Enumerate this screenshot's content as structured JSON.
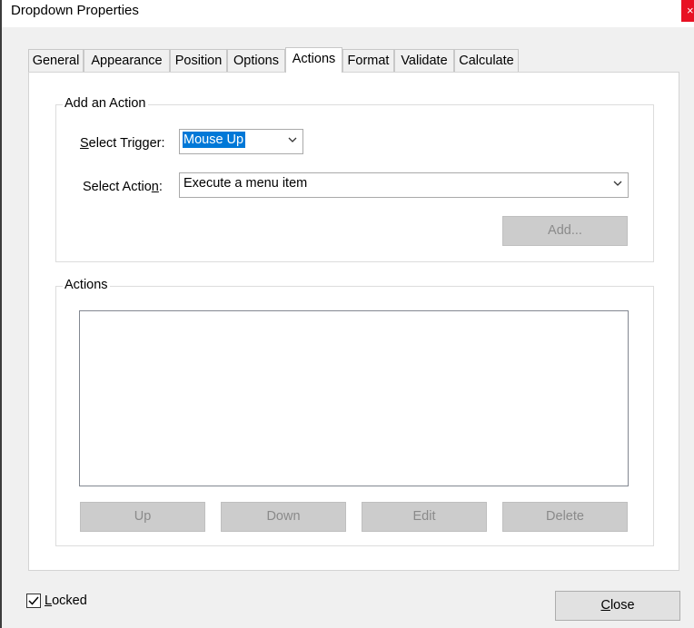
{
  "window": {
    "title": "Dropdown Properties",
    "close_glyph": "×"
  },
  "tabs": [
    {
      "label": "General"
    },
    {
      "label": "Appearance"
    },
    {
      "label": "Position"
    },
    {
      "label": "Options"
    },
    {
      "label": "Actions"
    },
    {
      "label": "Format"
    },
    {
      "label": "Validate"
    },
    {
      "label": "Calculate"
    }
  ],
  "add_action": {
    "group_label": "Add an Action",
    "trigger": {
      "label_mnemonic": "S",
      "label_rest": "elect Trigger:",
      "value": "Mouse Up"
    },
    "action": {
      "label_pre": "Select Actio",
      "label_mnemonic": "n",
      "label_post": ":",
      "value": "Execute a menu item"
    },
    "add_button": "Add..."
  },
  "actions_group": {
    "label": "Actions",
    "buttons": {
      "up": "Up",
      "down": "Down",
      "edit": "Edit",
      "delete": "Delete"
    }
  },
  "footer": {
    "locked_mnemonic": "L",
    "locked_rest": "ocked",
    "locked_checked": true,
    "close_mnemonic": "C",
    "close_rest": "lose"
  },
  "colors": {
    "selection": "#0078d7",
    "disabled_button": "#cccccc"
  }
}
